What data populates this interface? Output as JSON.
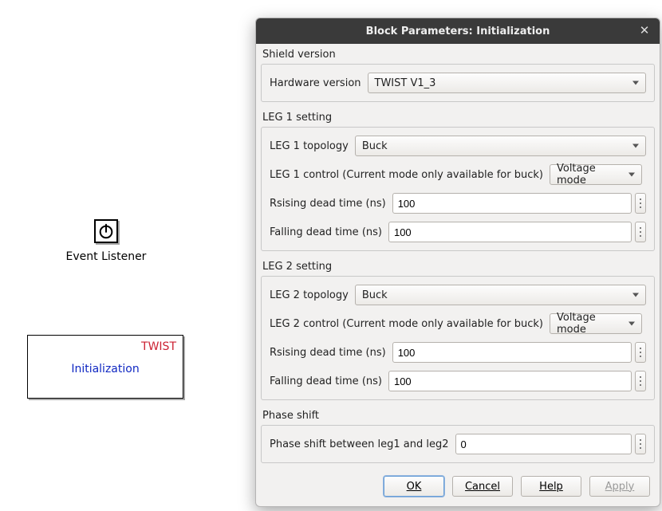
{
  "canvas": {
    "event_listener_label": "Event Listener",
    "init_block_category": "TWIST",
    "init_block_title": "Initialization"
  },
  "dialog": {
    "title": "Block Parameters: Initialization",
    "sections": {
      "shield": {
        "header": "Shield version",
        "hardware_version_label": "Hardware version",
        "hardware_version_value": "TWIST V1_3"
      },
      "leg1": {
        "header": "LEG 1 setting",
        "topology_label": "LEG 1 topology",
        "topology_value": "Buck",
        "control_label": "LEG 1 control (Current mode only available for buck)",
        "control_value": "Voltage mode",
        "rising_label": "Rsising dead time (ns)",
        "rising_value": "100",
        "falling_label": "Falling dead time (ns)",
        "falling_value": "100"
      },
      "leg2": {
        "header": "LEG 2 setting",
        "topology_label": "LEG 2 topology",
        "topology_value": "Buck",
        "control_label": "LEG 2 control (Current mode only available for buck)",
        "control_value": "Voltage mode",
        "rising_label": "Rsising dead time (ns)",
        "rising_value": "100",
        "falling_label": "Falling dead time (ns)",
        "falling_value": "100"
      },
      "phase": {
        "header": "Phase shift",
        "label": "Phase shift between leg1 and leg2",
        "value": "0"
      }
    },
    "buttons": {
      "ok": "OK",
      "cancel": "Cancel",
      "help": "Help",
      "apply": "Apply"
    }
  }
}
